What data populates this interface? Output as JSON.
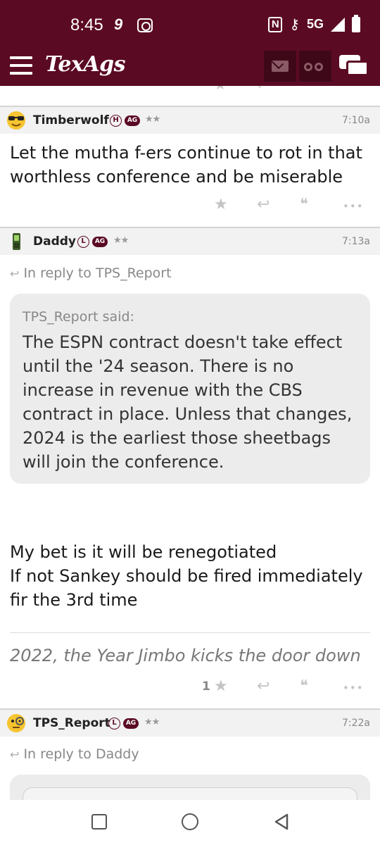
{
  "status_bar": {
    "time": "8:45",
    "left_icons": [
      "9",
      "screen-record-icon"
    ],
    "right_icons": [
      "nfc-icon",
      "key-icon",
      "5g-icon",
      "signal-icon",
      "battery-icon"
    ],
    "network": "5G"
  },
  "app_bar": {
    "logo": "TexAgs",
    "icons": [
      "menu-icon",
      "mail-icon",
      "binoculars-icon",
      "chat-icon"
    ],
    "colors": {
      "brand": "#5b0a24",
      "button_dark": "#3e0818"
    }
  },
  "posts": [
    {
      "username": "Timberwolf",
      "badge_letter": "H",
      "badge_ag": "AG",
      "stars": "★★",
      "time": "7:10a",
      "avatar": "sunglasses-emoji-icon",
      "body": "Let the mutha f-ers continue to rot in that worthless conference and be miserable",
      "star_count": ""
    },
    {
      "username": "Daddy",
      "badge_letter": "L",
      "badge_ag": "AG",
      "stars": "★★",
      "time": "7:13a",
      "avatar": "phone-icon",
      "reply_to": "In reply to TPS_Report",
      "quote_author": "TPS_Report said:",
      "quote_text": "The ESPN contract doesn't take effect until the '24 season. There is no increase in revenue with the CBS contract in place. Unless that changes, 2024 is the earliest those sheetbags will join the conference.",
      "body_lines": [
        "My bet is it will be renegotiated",
        "If not Sankey should be fired immediately",
        "fir the 3rd time"
      ],
      "signature": "2022, the Year Jimbo kicks the door down",
      "star_count": "1"
    },
    {
      "username": "TPS_Report",
      "badge_letter": "L",
      "badge_ag": "AG",
      "stars": "★★",
      "time": "7:22a",
      "avatar": "monocle-emoji-icon",
      "reply_to": "In reply to Daddy"
    }
  ],
  "action_icons": [
    "star-icon",
    "reply-icon",
    "quote-icon",
    "more-icon"
  ],
  "action_glyphs": {
    "star": "★",
    "reply": "↩",
    "quote": "❝",
    "more": "•••"
  },
  "nav_bar": {
    "icons": [
      "recents-icon",
      "home-icon",
      "back-icon"
    ]
  }
}
